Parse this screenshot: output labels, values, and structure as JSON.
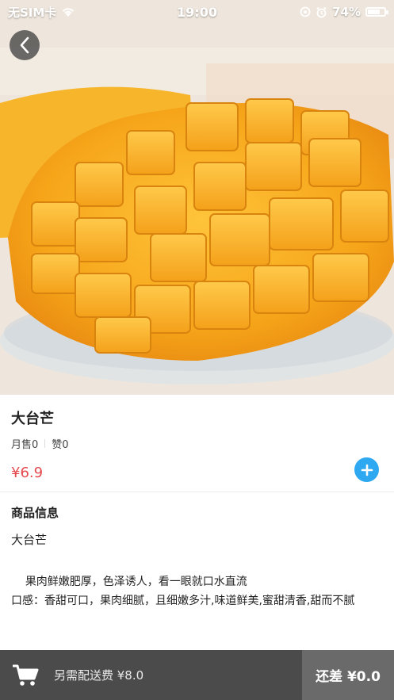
{
  "status_bar": {
    "carrier": "无SIM卡",
    "time": "19:00",
    "battery": "74%",
    "battery_level": 0.74,
    "icons": [
      "wifi-icon",
      "rotation-lock-icon",
      "alarm-icon",
      "battery-icon"
    ]
  },
  "hero": {
    "image": "mango-cut-image"
  },
  "product": {
    "name": "大台芒",
    "sales": "月售0",
    "likes": "赞0",
    "price": "¥6.9"
  },
  "details": {
    "section_title": "商品信息",
    "name_line": "大台芒",
    "description": "    果肉鲜嫩肥厚，色泽诱人，看一眼就口水直流\n口感：香甜可口，果肉细腻，且细嫩多汁,味道鲜美,蜜甜清香,甜而不腻"
  },
  "cart_bar": {
    "delivery_note": "另需配送费 ¥8.0",
    "remaining": "还差 ¥0.0"
  },
  "colors": {
    "price": "#e5484d",
    "add_button": "#2ea8f0",
    "cart_bar": "#4b4b4b",
    "checkout": "#6a6a6a"
  }
}
